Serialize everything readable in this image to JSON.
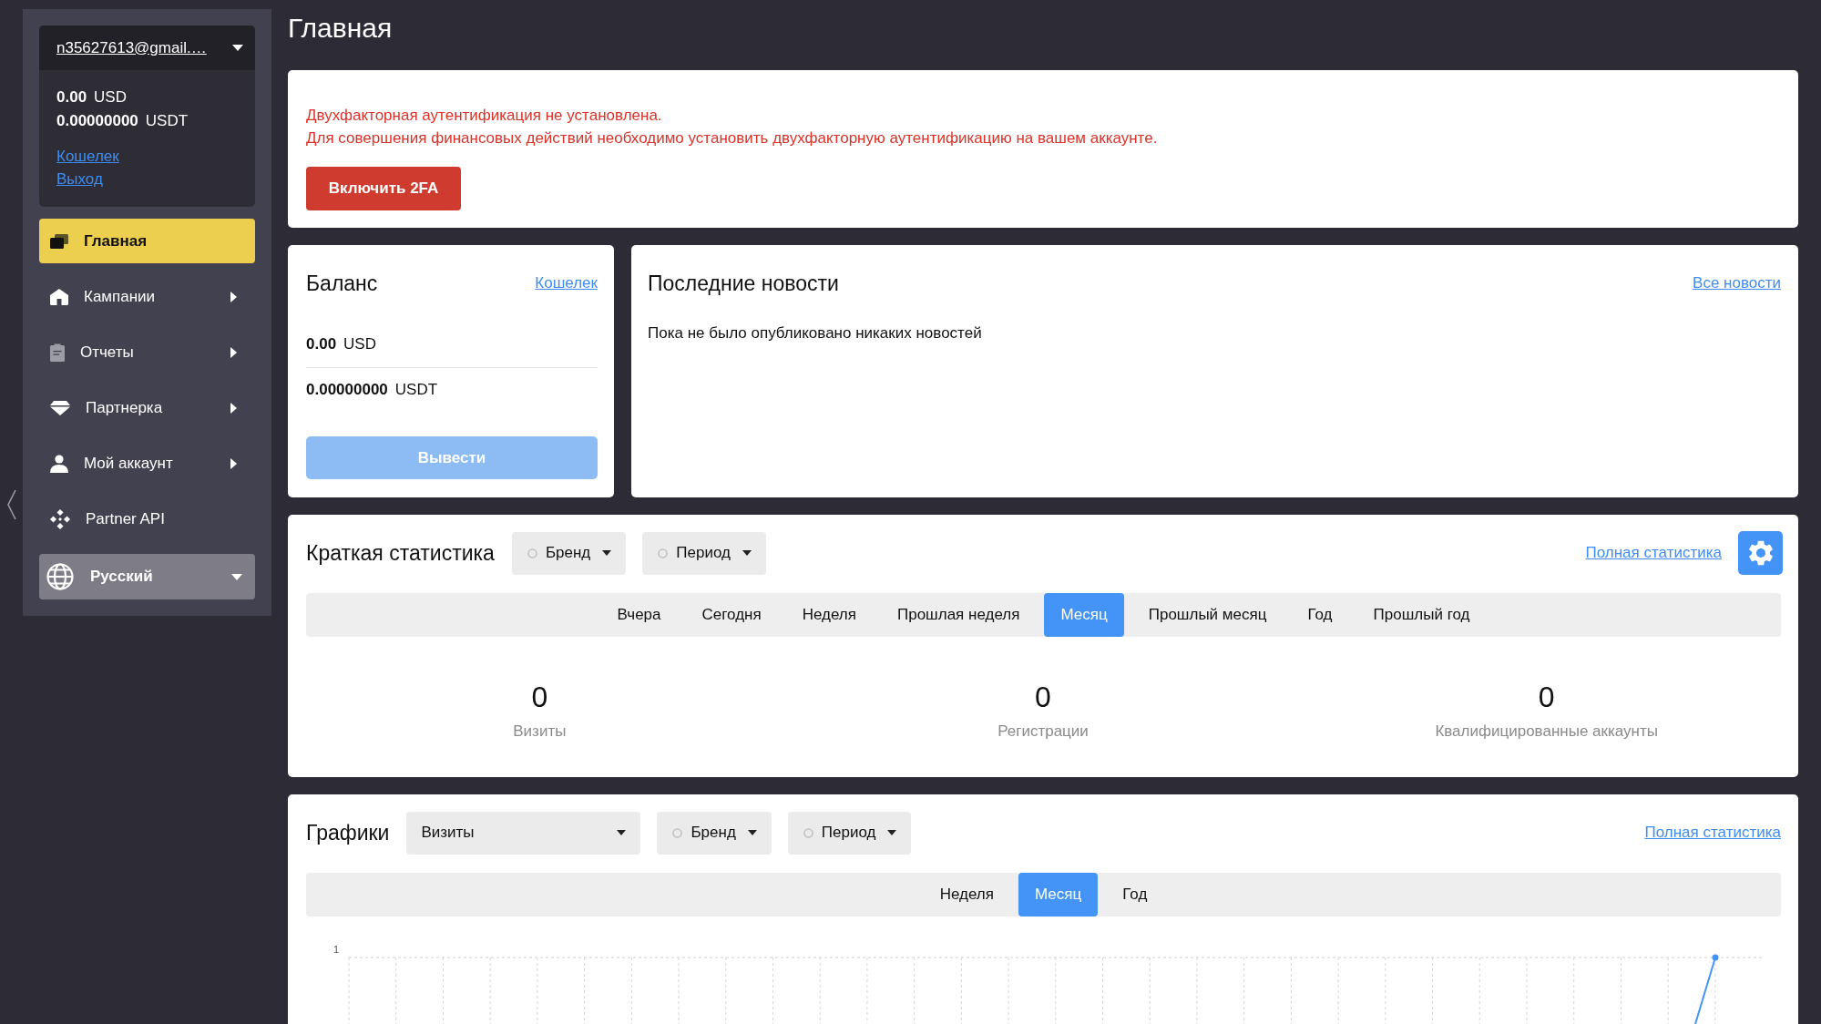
{
  "sidebar": {
    "account": {
      "email": "n35627613@gmail.…",
      "balances": [
        {
          "amount": "0.00",
          "currency": "USD"
        },
        {
          "amount": "0.00000000",
          "currency": "USDT"
        }
      ],
      "links": [
        "Кошелек",
        "Выход"
      ]
    },
    "nav": [
      {
        "label": "Главная",
        "selected": true,
        "submenu": false
      },
      {
        "label": "Кампании",
        "selected": false,
        "submenu": true
      },
      {
        "label": "Отчеты",
        "selected": false,
        "submenu": true
      },
      {
        "label": "Партнерка",
        "selected": false,
        "submenu": true
      },
      {
        "label": "Мой аккаунт",
        "selected": false,
        "submenu": true
      },
      {
        "label": "Partner API",
        "selected": false,
        "submenu": false
      }
    ],
    "language": {
      "label": "Русский"
    }
  },
  "page": {
    "title": "Главная"
  },
  "alert": {
    "lines": [
      "Двухфакторная аутентификация не установлена.",
      "Для совершения финансовых действий необходимо установить двухфакторную аутентификацию на вашем аккаунте."
    ],
    "button": "Включить 2FA"
  },
  "balance": {
    "title": "Баланс",
    "link": "Кошелек",
    "rows": [
      {
        "amount": "0.00",
        "currency": "USD"
      },
      {
        "amount": "0.00000000",
        "currency": "USDT"
      }
    ],
    "button": {
      "label": "Вывести",
      "disabled": true
    }
  },
  "news": {
    "title": "Последние новости",
    "link": "Все новости",
    "empty_text": "Пока не было опубликовано никаких новостей"
  },
  "stats": {
    "title": "Краткая статистика",
    "filters": [
      "Бренд",
      "Период"
    ],
    "link": "Полная статистика",
    "tabs": [
      {
        "label": "Вчера",
        "selected": false
      },
      {
        "label": "Сегодня",
        "selected": false
      },
      {
        "label": "Неделя",
        "selected": false
      },
      {
        "label": "Прошлая неделя",
        "selected": false
      },
      {
        "label": "Месяц",
        "selected": true
      },
      {
        "label": "Прошлый месяц",
        "selected": false
      },
      {
        "label": "Год",
        "selected": false
      },
      {
        "label": "Прошлый год",
        "selected": false
      }
    ],
    "metrics": [
      {
        "value": "0",
        "label": "Визиты"
      },
      {
        "value": "0",
        "label": "Регистрации"
      },
      {
        "value": "0",
        "label": "Квалифицированные аккаунты"
      }
    ]
  },
  "graphs": {
    "title": "Графики",
    "metric_select": "Визиты",
    "filters": [
      "Бренд",
      "Период"
    ],
    "link": "Полная статистика",
    "tabs": [
      {
        "label": "Неделя",
        "selected": false
      },
      {
        "label": "Месяц",
        "selected": true
      },
      {
        "label": "Год",
        "selected": false
      }
    ],
    "chart": {
      "y_tick": "1"
    }
  }
}
